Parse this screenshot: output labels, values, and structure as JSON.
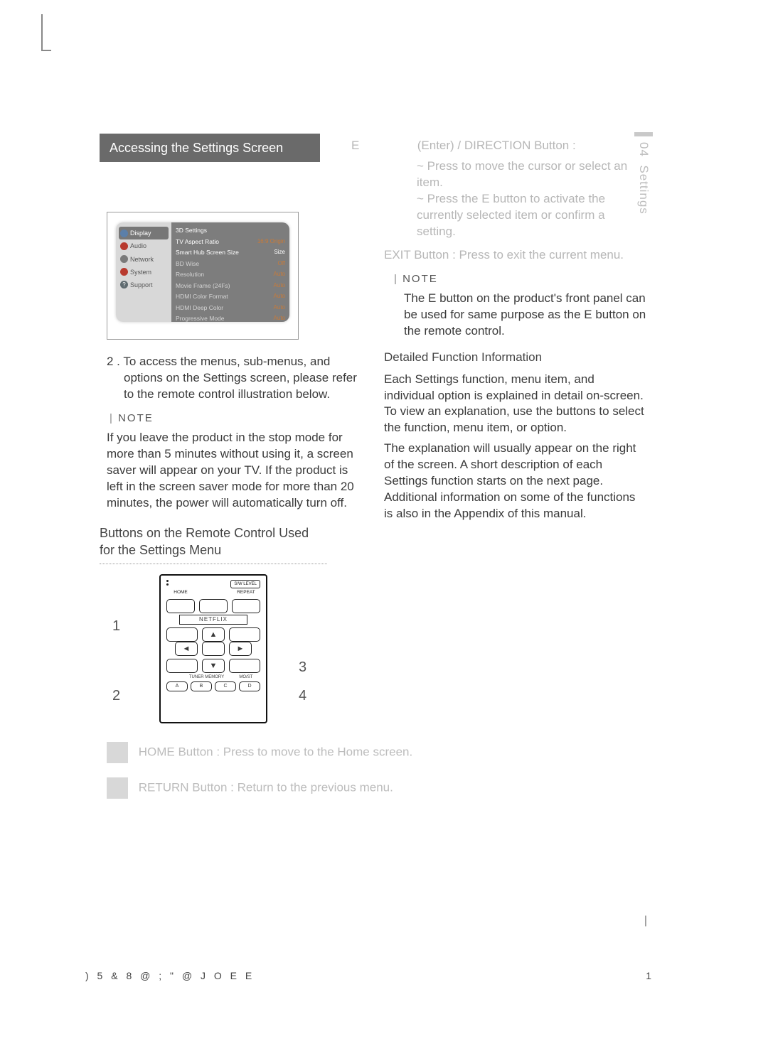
{
  "side": {
    "chapter": "04",
    "title": "Settings"
  },
  "left": {
    "section_title": "Accessing the Settings Screen",
    "settings_nav": [
      "Display",
      "Audio",
      "Network",
      "System",
      "Support"
    ],
    "settings_rows": [
      {
        "label": "3D Settings",
        "value": ""
      },
      {
        "label": "TV Aspect Ratio",
        "value": "16:9 Origin"
      },
      {
        "label": "Smart Hub Screen Size",
        "value": "Size"
      },
      {
        "label": "BD Wise",
        "value": "Off"
      },
      {
        "label": "Resolution",
        "value": "Auto"
      },
      {
        "label": "Movie Frame (24Fs)",
        "value": "Auto"
      },
      {
        "label": "HDMI Color Format",
        "value": "Auto"
      },
      {
        "label": "HDMI Deep Color",
        "value": "Auto"
      },
      {
        "label": "Progressive Mode",
        "value": "Auto"
      }
    ],
    "step2": "2 .  To access the menus, sub-menus, and options on the Settings screen, please refer to the remote control illustration below.",
    "note_label": "NOTE",
    "note_body": "If you leave the product in the stop mode for more than 5 minutes without using it, a screen saver will appear on your TV. If the product is left in the screen saver mode for more than 20 minutes, the power will automatically turn off.",
    "sub_heading": "Buttons on the Remote Control Used for the Settings Menu",
    "remote": {
      "sw": "S/W LEVEL",
      "home": "HOME",
      "repeat": "REPEAT",
      "netflix": "NETFLIX",
      "tuner": "TUNER MEMORY",
      "moist": "MO/ST",
      "a": "A",
      "b": "B",
      "c": "C",
      "d": "D"
    },
    "callouts": {
      "n1": "1",
      "n2": "2",
      "n3": "3",
      "n4": "4"
    }
  },
  "right": {
    "enter_lead": "E",
    "enter_title": "(Enter) / DIRECTION Button :",
    "enter_l1": "~ Press            to move the cursor or select an item.",
    "enter_l2a": "~ Press the ",
    "enter_l2b": "E",
    "enter_l2c": " button to activate the currently selected item or confirm a setting.",
    "exit_lead": "EXIT",
    "exit_text": "Button : Press to exit the current menu.",
    "note_label": "NOTE",
    "note_body_a": "The ",
    "note_body_b": "E",
    "note_body_c": " button on the product's front panel can be used for same purpose as the ",
    "note_body_d": "E",
    "note_body_e": " button on the remote control.",
    "dfi_heading": "Detailed Function Information",
    "dfi_p1": "Each Settings function, menu item, and individual option is explained in detail on-screen. To view an explanation, use the            buttons to select the function, menu item, or option.",
    "dfi_p2": "The explanation will usually appear on the right of the screen. A short description of each Settings function starts on the next page. Additional information on some of the functions is also in the Appendix of this manual."
  },
  "btn_explain": {
    "home": "HOME Button : Press to move to the Home screen.",
    "return": "RETURN Button : Return to the previous menu."
  },
  "footer": {
    "left": ") 5  &     8 @ ; \" @      J O E E",
    "right": "1"
  }
}
